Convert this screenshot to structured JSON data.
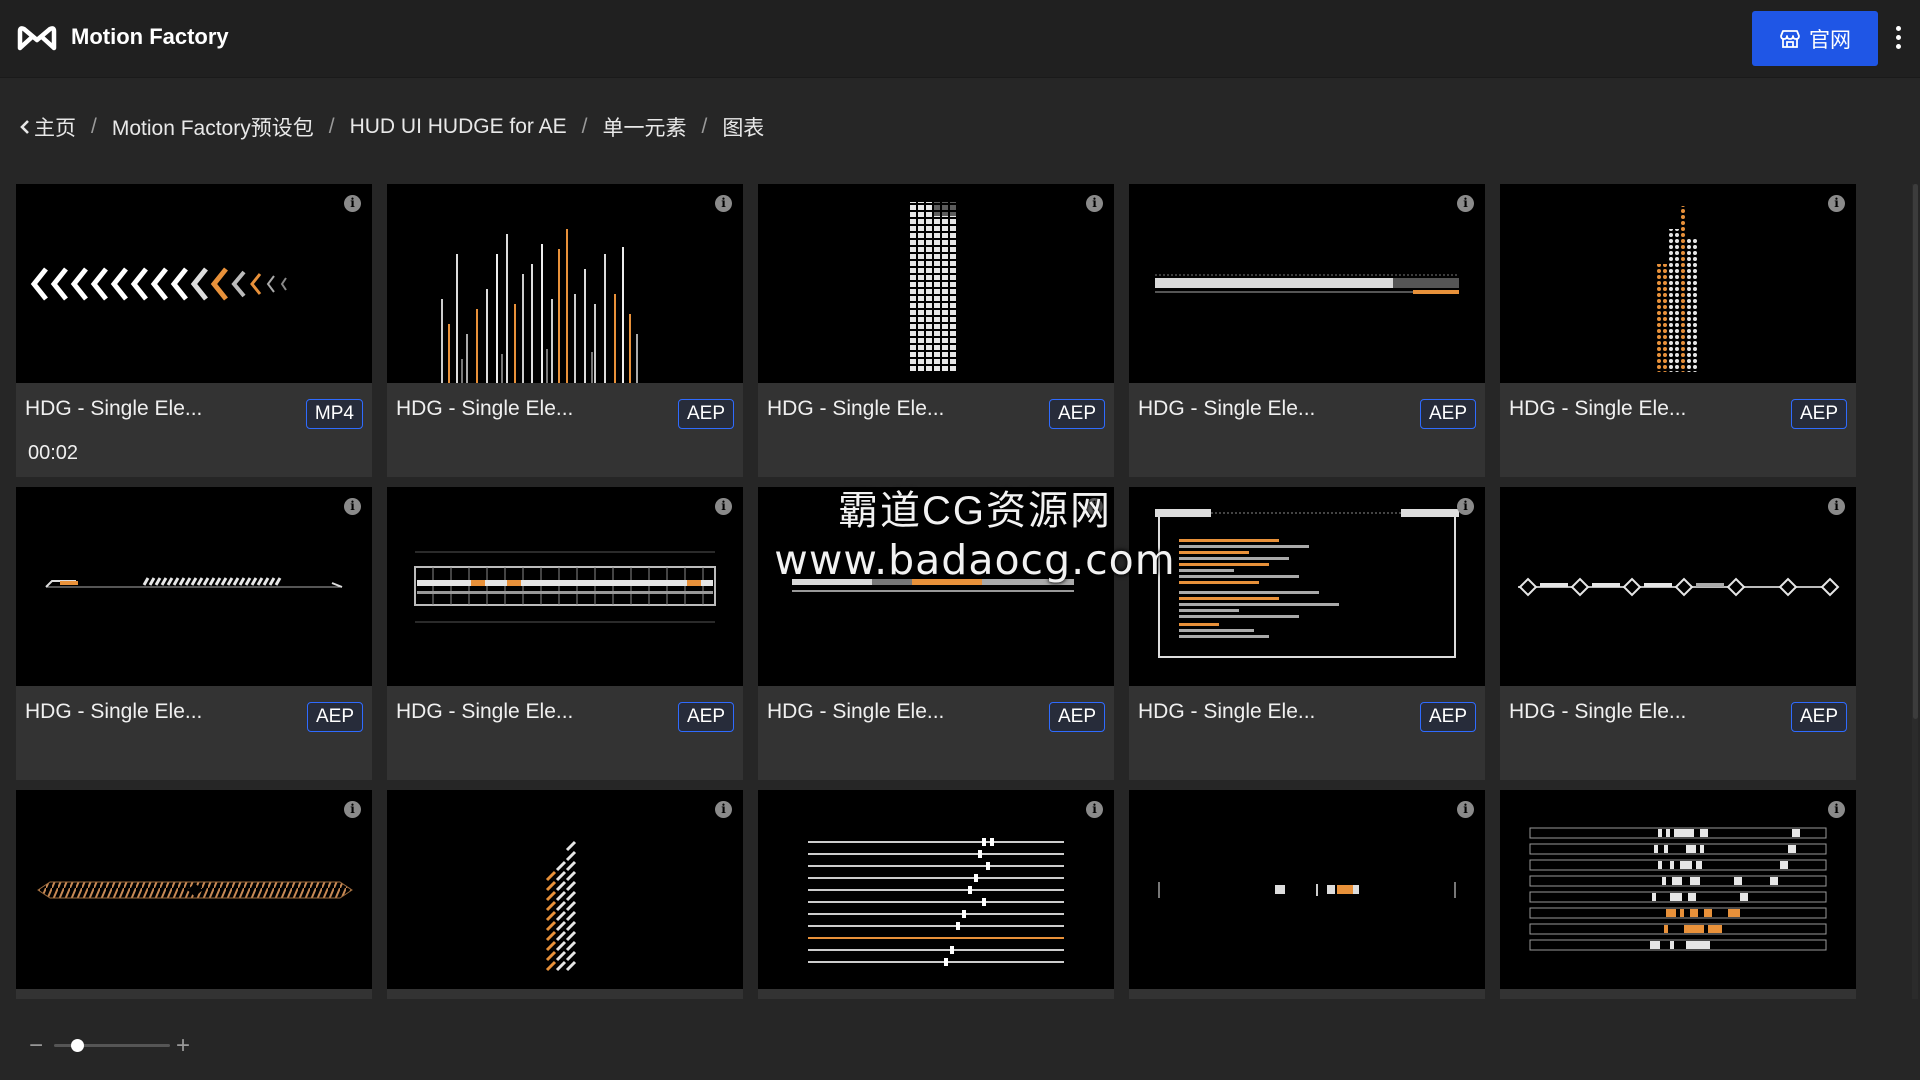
{
  "app": {
    "title": "Motion Factory"
  },
  "header": {
    "site_button_label": "官网"
  },
  "breadcrumb": {
    "items": [
      "主页",
      "Motion Factory预设包",
      "HUD UI HUDGE for AE",
      "单一元素",
      "图表"
    ],
    "separator": "/"
  },
  "cards": [
    {
      "title": "HDG - Single Ele...",
      "badge": "MP4",
      "duration": "00:02"
    },
    {
      "title": "HDG - Single Ele...",
      "badge": "AEP"
    },
    {
      "title": "HDG - Single Ele...",
      "badge": "AEP"
    },
    {
      "title": "HDG - Single Ele...",
      "badge": "AEP"
    },
    {
      "title": "HDG - Single Ele...",
      "badge": "AEP"
    },
    {
      "title": "HDG - Single Ele...",
      "badge": "AEP"
    },
    {
      "title": "HDG - Single Ele...",
      "badge": "AEP"
    },
    {
      "title": "HDG - Single Ele...",
      "badge": "AEP"
    },
    {
      "title": "HDG - Single Ele...",
      "badge": "AEP"
    },
    {
      "title": "HDG - Single Ele...",
      "badge": "AEP"
    },
    {
      "title": "",
      "badge": ""
    },
    {
      "title": "",
      "badge": ""
    },
    {
      "title": "",
      "badge": ""
    },
    {
      "title": "",
      "badge": ""
    },
    {
      "title": "",
      "badge": ""
    }
  ],
  "info_icon_glyph": "i",
  "watermark": {
    "line1": "霸道CG资源网",
    "line2": "www.badaocg.com"
  },
  "zoom": {
    "minus": "−",
    "plus": "+",
    "level": 0.2
  },
  "colors": {
    "accent": "#1f56e6",
    "badge_border": "#2f6bff",
    "orange": "#e8913a",
    "card_bg": "#333333"
  }
}
